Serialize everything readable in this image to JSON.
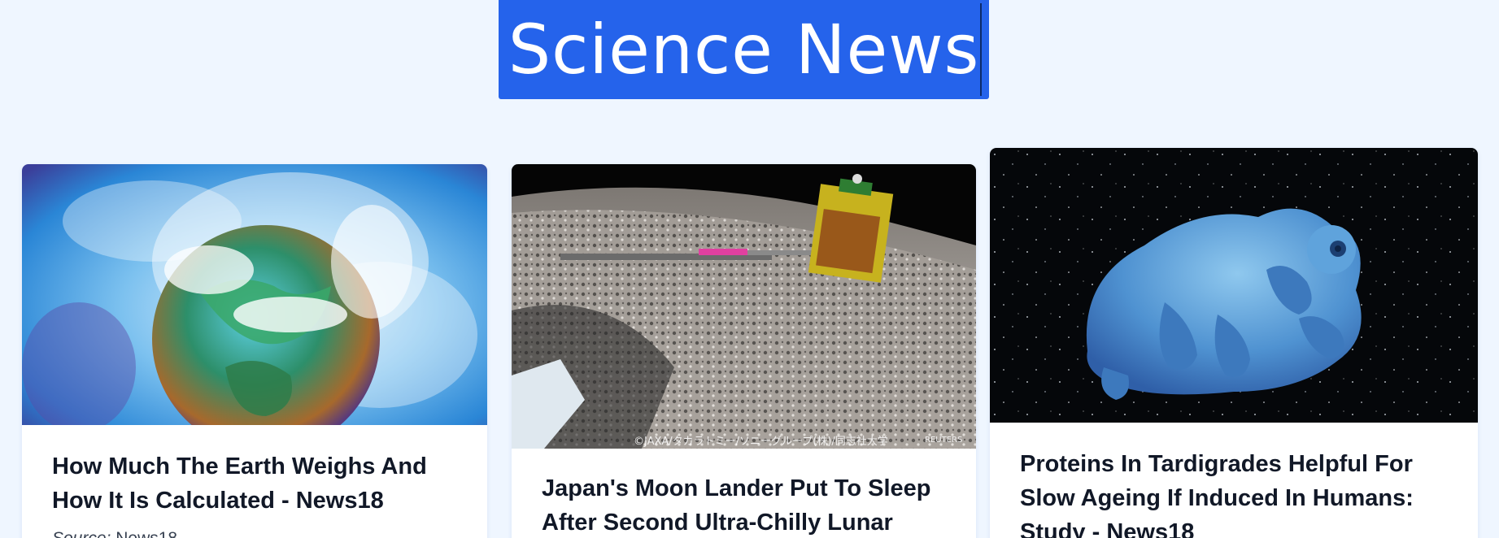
{
  "header": {
    "title": "Science News"
  },
  "articles": [
    {
      "title": "How Much The Earth Weighs And How It Is Calculated - News18",
      "source_label": "Source:",
      "source_name": "News18",
      "image_icon": "earth-illustration"
    },
    {
      "title": "Japan's Moon Lander Put To Sleep After Second Ultra-Chilly Lunar",
      "image_icon": "moon-lander-photo",
      "image_watermark": "©JAXA/タカラトミー/ソニーグループ(株)/同志社大学",
      "image_credit": "REUTERS"
    },
    {
      "title": "Proteins In Tardigrades Helpful For Slow Ageing If Induced In Humans: Study - News18",
      "image_icon": "tardigrade-illustration"
    }
  ],
  "colors": {
    "background": "#eff6ff",
    "header_bg": "#2563eb",
    "card_bg": "#ffffff",
    "title_text": "#111827"
  }
}
